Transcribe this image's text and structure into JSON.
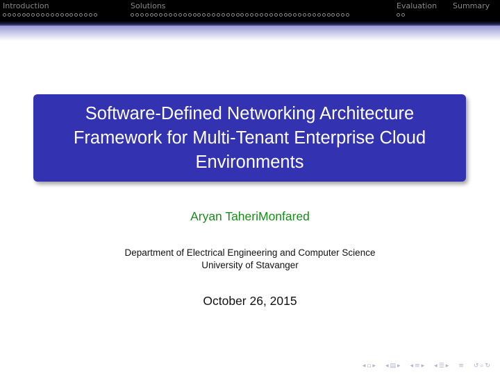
{
  "nav": {
    "sections": [
      {
        "title": "Introduction",
        "dots": 20
      },
      {
        "title": "Solutions",
        "dots": 46
      },
      {
        "title": "Evaluation",
        "dots": 2
      },
      {
        "title": "Summary",
        "dots": 0
      }
    ]
  },
  "slide": {
    "title": "Software-Defined Networking Architecture Framework for Multi-Tenant Enterprise Cloud Environments",
    "author": "Aryan TaheriMonfared",
    "institute_line1": "Department of Electrical Engineering and Computer Science",
    "institute_line2": "University of Stavanger",
    "date": "October 26, 2015"
  },
  "colors": {
    "title_box": "#3333b2",
    "author": "#1a8a1a",
    "header_bg": "#000000"
  },
  "icons": [
    "nav-prev-frame-icon",
    "nav-next-frame-icon",
    "nav-prev-subsection-icon",
    "nav-next-subsection-icon",
    "nav-prev-section-icon",
    "nav-next-section-icon",
    "nav-align-icon",
    "nav-search-icon"
  ]
}
